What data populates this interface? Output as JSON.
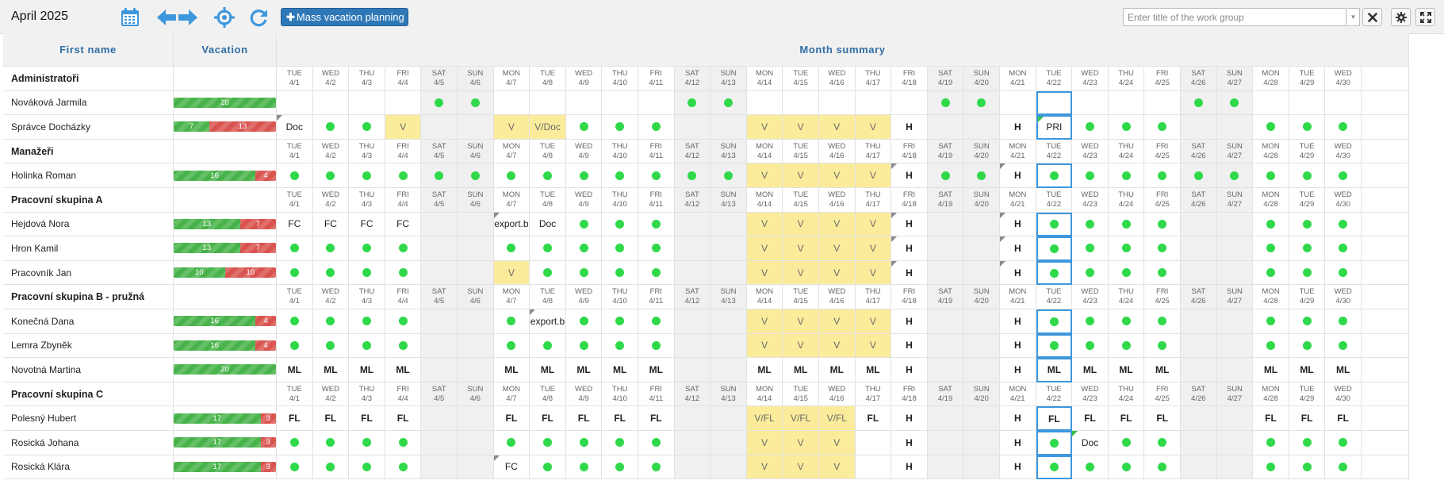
{
  "toolbar": {
    "month_title": "April 2025",
    "icons": [
      "calendar-icon",
      "arrow-left-icon",
      "arrow-right-icon",
      "crosshair-icon",
      "refresh-icon"
    ],
    "mass_vacation_label": "Mass vacation planning",
    "workgroup_placeholder": "Enter title of the work group",
    "accent_color": "#2f78b7",
    "icon_color": "#3d97dd"
  },
  "grid": {
    "col_name_header": "First name",
    "col_vacation_header": "Vacation",
    "month_summary_header": "Month summary",
    "days": [
      {
        "dow": "TUE",
        "date": "4/1"
      },
      {
        "dow": "WED",
        "date": "4/2"
      },
      {
        "dow": "THU",
        "date": "4/3"
      },
      {
        "dow": "FRI",
        "date": "4/4"
      },
      {
        "dow": "SAT",
        "date": "4/5"
      },
      {
        "dow": "SUN",
        "date": "4/6"
      },
      {
        "dow": "MON",
        "date": "4/7"
      },
      {
        "dow": "TUE",
        "date": "4/8"
      },
      {
        "dow": "WED",
        "date": "4/9"
      },
      {
        "dow": "THU",
        "date": "4/10"
      },
      {
        "dow": "FRI",
        "date": "4/11"
      },
      {
        "dow": "SAT",
        "date": "4/12"
      },
      {
        "dow": "SUN",
        "date": "4/13"
      },
      {
        "dow": "MON",
        "date": "4/14"
      },
      {
        "dow": "TUE",
        "date": "4/15"
      },
      {
        "dow": "WED",
        "date": "4/16"
      },
      {
        "dow": "THU",
        "date": "4/17"
      },
      {
        "dow": "FRI",
        "date": "4/18"
      },
      {
        "dow": "SAT",
        "date": "4/19"
      },
      {
        "dow": "SUN",
        "date": "4/20"
      },
      {
        "dow": "MON",
        "date": "4/21"
      },
      {
        "dow": "TUE",
        "date": "4/22"
      },
      {
        "dow": "WED",
        "date": "4/23"
      },
      {
        "dow": "THU",
        "date": "4/24"
      },
      {
        "dow": "FRI",
        "date": "4/25"
      },
      {
        "dow": "SAT",
        "date": "4/26"
      },
      {
        "dow": "SUN",
        "date": "4/27"
      },
      {
        "dow": "MON",
        "date": "4/28"
      },
      {
        "dow": "TUE",
        "date": "4/29"
      },
      {
        "dow": "WED",
        "date": "4/30"
      }
    ],
    "weekend_indices": [
      4,
      5,
      11,
      12,
      18,
      19,
      25,
      26
    ],
    "today_index": 21,
    "cell_legend": {
      "d": "present (green dot)",
      "V": "vacation",
      "H": "holiday"
    },
    "groups": [
      {
        "name": "Administratoři",
        "people": [
          {
            "name": "Nováková Jarmila",
            "vacation": {
              "green": 20,
              "red": 0
            },
            "cells": [
              "",
              "",
              "",
              "",
              "d",
              "d",
              "",
              "",
              "",
              "",
              "",
              "d",
              "d",
              "",
              "",
              "",
              "",
              "",
              "d",
              "d",
              "",
              "",
              "",
              "",
              "",
              "d",
              "d",
              "",
              "",
              ""
            ],
            "vac_days": [],
            "marks": [],
            "green_marks": []
          },
          {
            "name": "Správce Docházky",
            "vacation": {
              "green": 7,
              "red": 13
            },
            "cells": [
              "Doc",
              "d",
              "d",
              "V",
              "",
              "",
              "V",
              "V/Doc",
              "d",
              "d",
              "d",
              "",
              "",
              "V",
              "V",
              "V",
              "V",
              "H",
              "",
              "",
              "H",
              "PRI",
              "d",
              "d",
              "d",
              "",
              "",
              "d",
              "d",
              "d"
            ],
            "vac_days": [
              3,
              6,
              7,
              13,
              14,
              15,
              16
            ],
            "marks": [
              0
            ],
            "green_marks": [
              21
            ]
          }
        ]
      },
      {
        "name": "Manažeři",
        "people": [
          {
            "name": "Holinka Roman",
            "vacation": {
              "green": 16,
              "red": 4
            },
            "cells": [
              "d",
              "d",
              "d",
              "d",
              "d",
              "d",
              "d",
              "d",
              "d",
              "d",
              "d",
              "d",
              "d",
              "V",
              "V",
              "V",
              "V",
              "H",
              "d",
              "d",
              "H",
              "d",
              "d",
              "d",
              "d",
              "d",
              "d",
              "d",
              "d",
              "d"
            ],
            "vac_days": [
              13,
              14,
              15,
              16
            ],
            "marks": [
              17,
              20
            ],
            "green_marks": []
          }
        ]
      },
      {
        "name": "Pracovní skupina A",
        "people": [
          {
            "name": "Hejdová Nora",
            "vacation": {
              "green": 13,
              "red": 7
            },
            "cells": [
              "FC",
              "FC",
              "FC",
              "FC",
              "",
              "",
              "export.b",
              "Doc",
              "d",
              "d",
              "d",
              "",
              "",
              "V",
              "V",
              "V",
              "V",
              "H",
              "",
              "",
              "H",
              "d",
              "d",
              "d",
              "d",
              "",
              "",
              "d",
              "d",
              "d"
            ],
            "vac_days": [
              13,
              14,
              15,
              16
            ],
            "marks": [
              6,
              17,
              20
            ],
            "green_marks": []
          },
          {
            "name": "Hron Kamil",
            "vacation": {
              "green": 13,
              "red": 7
            },
            "cells": [
              "d",
              "d",
              "d",
              "d",
              "",
              "",
              "d",
              "d",
              "d",
              "d",
              "d",
              "",
              "",
              "V",
              "V",
              "V",
              "V",
              "H",
              "",
              "",
              "H",
              "d",
              "d",
              "d",
              "d",
              "",
              "",
              "d",
              "d",
              "d"
            ],
            "vac_days": [
              13,
              14,
              15,
              16
            ],
            "marks": [
              17,
              20
            ],
            "green_marks": []
          },
          {
            "name": "Pracovník Jan",
            "vacation": {
              "green": 10,
              "red": 10
            },
            "cells": [
              "d",
              "d",
              "d",
              "d",
              "",
              "",
              "V",
              "d",
              "d",
              "d",
              "d",
              "",
              "",
              "V",
              "V",
              "V",
              "V",
              "H",
              "",
              "",
              "H",
              "d",
              "d",
              "d",
              "d",
              "",
              "",
              "d",
              "d",
              "d"
            ],
            "vac_days": [
              6,
              13,
              14,
              15,
              16
            ],
            "marks": [
              17,
              20
            ],
            "green_marks": []
          }
        ]
      },
      {
        "name": "Pracovní skupina B - pružná",
        "people": [
          {
            "name": "Konečná Dana",
            "vacation": {
              "green": 16,
              "red": 4
            },
            "cells": [
              "d",
              "d",
              "d",
              "d",
              "",
              "",
              "d",
              "export.b",
              "d",
              "d",
              "d",
              "",
              "",
              "V",
              "V",
              "V",
              "V",
              "H",
              "",
              "",
              "H",
              "d",
              "d",
              "d",
              "d",
              "",
              "",
              "d",
              "d",
              "d"
            ],
            "vac_days": [
              13,
              14,
              15,
              16
            ],
            "marks": [
              7
            ],
            "green_marks": []
          },
          {
            "name": "Lemra Zbyněk",
            "vacation": {
              "green": 16,
              "red": 4
            },
            "cells": [
              "d",
              "d",
              "d",
              "d",
              "",
              "",
              "d",
              "d",
              "d",
              "d",
              "d",
              "",
              "",
              "V",
              "V",
              "V",
              "V",
              "H",
              "",
              "",
              "H",
              "d",
              "d",
              "d",
              "d",
              "",
              "",
              "d",
              "d",
              "d"
            ],
            "vac_days": [
              13,
              14,
              15,
              16
            ],
            "marks": [],
            "green_marks": []
          },
          {
            "name": "Novotná Martina",
            "vacation": {
              "green": 20,
              "red": 0
            },
            "cells": [
              "ML",
              "ML",
              "ML",
              "ML",
              "",
              "",
              "ML",
              "ML",
              "ML",
              "ML",
              "ML",
              "",
              "",
              "ML",
              "ML",
              "ML",
              "ML",
              "H",
              "",
              "",
              "H",
              "ML",
              "ML",
              "ML",
              "ML",
              "",
              "",
              "ML",
              "ML",
              "ML"
            ],
            "vac_days": [],
            "marks": [],
            "green_marks": []
          }
        ]
      },
      {
        "name": "Pracovní skupina C",
        "people": [
          {
            "name": "Polesný Hubert",
            "vacation": {
              "green": 17,
              "red": 3
            },
            "cells": [
              "FL",
              "FL",
              "FL",
              "FL",
              "",
              "",
              "FL",
              "FL",
              "FL",
              "FL",
              "FL",
              "",
              "",
              "V/FL",
              "V/FL",
              "V/FL",
              "FL",
              "H",
              "",
              "",
              "H",
              "FL",
              "FL",
              "FL",
              "FL",
              "",
              "",
              "FL",
              "FL",
              "FL"
            ],
            "vac_days": [
              13,
              14,
              15
            ],
            "marks": [],
            "green_marks": []
          },
          {
            "name": "Rosická Johana",
            "vacation": {
              "green": 17,
              "red": 3
            },
            "cells": [
              "d",
              "d",
              "d",
              "d",
              "",
              "",
              "d",
              "d",
              "d",
              "d",
              "d",
              "",
              "",
              "V",
              "V",
              "V",
              "",
              "H",
              "",
              "",
              "H",
              "d",
              "Doc",
              "d",
              "d",
              "",
              "",
              "d",
              "d",
              "d"
            ],
            "vac_days": [
              13,
              14,
              15
            ],
            "marks": [],
            "green_marks": [
              22
            ]
          },
          {
            "name": "Rosická Klára",
            "vacation": {
              "green": 17,
              "red": 3
            },
            "cells": [
              "d",
              "d",
              "d",
              "d",
              "",
              "",
              "FC",
              "d",
              "d",
              "d",
              "d",
              "",
              "",
              "V",
              "V",
              "V",
              "",
              "H",
              "",
              "",
              "H",
              "d",
              "d",
              "d",
              "d",
              "",
              "",
              "d",
              "d",
              "d"
            ],
            "vac_days": [
              13,
              14,
              15
            ],
            "marks": [
              6
            ],
            "green_marks": []
          }
        ]
      }
    ]
  }
}
